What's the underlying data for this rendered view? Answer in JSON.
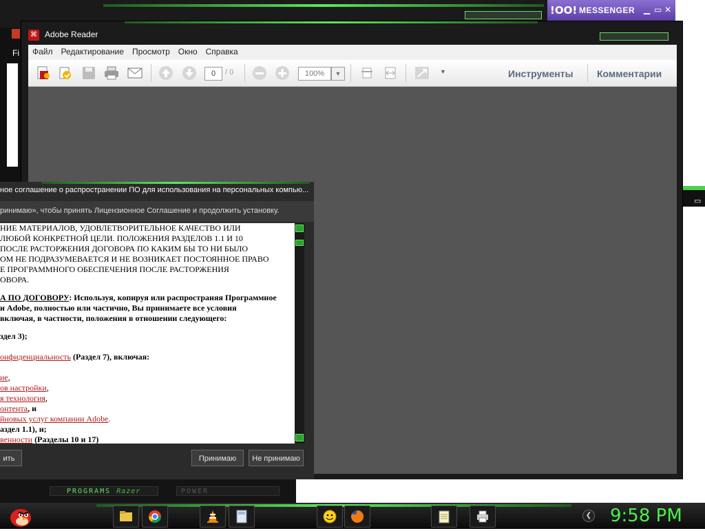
{
  "yahoo_messenger": {
    "logo": "!OO!",
    "title": "MESSENGER",
    "minimize": "▭",
    "close": "✕"
  },
  "background_window": {
    "menu_fragment": "Fi"
  },
  "adobe_reader": {
    "title": "Adobe Reader",
    "menu": [
      "Файл",
      "Редактирование",
      "Просмотр",
      "Окно",
      "Справка"
    ],
    "page_number": "0",
    "page_count": "/ 0",
    "zoom": "100%",
    "tools_link": "Инструменты",
    "comments_link": "Комментарии"
  },
  "license_dialog": {
    "title": "ное соглашение о распространении ПО для использования на персональных компью...",
    "instruction": "ринимаю», чтобы принять Лицензионное Соглашение и продолжить установку.",
    "text_lines": [
      "НИЕ МАТЕРИАЛОВ, УДОВЛЕТВОРИТЕЛЬНОЕ КАЧЕСТВО ИЛИ",
      "ЛЮБОЙ КОНКРЕТНОЙ ЦЕЛИ. ПОЛОЖЕНИЯ РАЗДЕЛОВ 1.1 И 10",
      "ПОСЛЕ РАСТОРЖЕНИЯ ДОГОВОРА ПО КАКИМ БЫ ТО НИ БЫЛО",
      "ОМ НЕ ПОДРАЗУМЕВАЕТСЯ И НЕ ВОЗНИКАЕТ ПОСТОЯННОЕ ПРАВО",
      "Е ПРОГРАММНОГО ОБЕСПЕЧЕНИЯ ПОСЛЕ РАСТОРЖЕНИЯ",
      "ОВОРА."
    ],
    "section_heading": "А ПО ДОГОВОРУ",
    "section_text_1": ": Используя, копируя или распространяя Программное",
    "section_text_2": "и Adobe, полностью или частично, Вы принимаете все условия",
    "section_text_3": "включая, в частности, положения в отношении следующего:",
    "item_razdel3": "здел 3);",
    "item_conf_link": "онфиденциальность",
    "item_conf_rest": " (Раздел 7), включая:",
    "item_1_link": "ие",
    "item_1_rest": ",",
    "item_2_link": "ов настройки",
    "item_2_rest": ",",
    "item_3_link": "я технология",
    "item_3_rest": ",",
    "item_4_link": "онтента",
    "item_4_rest": ", и",
    "item_5_link": "йновых услуг компании Adobe",
    "item_5_rest": ".",
    "item_6": "аздел 1.1), и;",
    "item_7_link": "венности",
    "item_7_rest": " (Разделы 10 и 17)",
    "left_button": "ить",
    "accept_button": "Принимаю",
    "decline_button": "Не принимаю"
  },
  "dock": {
    "programs": "PROGRAMS",
    "razer": "Razer",
    "power": "POWER"
  },
  "taskbar": {
    "clock": "9:58 PM",
    "colors": {
      "accent": "#5be85b",
      "clock": "#4cf04c"
    }
  }
}
